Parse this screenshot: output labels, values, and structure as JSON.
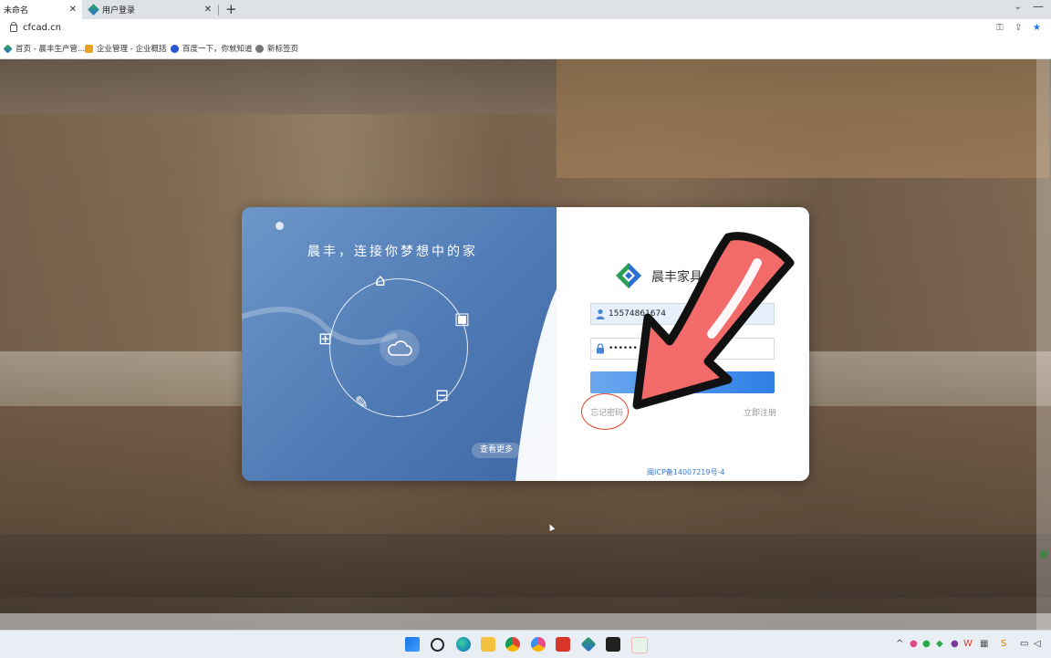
{
  "browser": {
    "tabs": [
      {
        "label": "未命名",
        "active": true
      },
      {
        "label": "用户登录",
        "active": false
      }
    ],
    "new_tab": "+",
    "url": "cfcad.cn",
    "bookmarks": [
      {
        "label": "首页 - 晨丰生产管..."
      },
      {
        "label": "企业管理 - 企业概括"
      },
      {
        "label": "百度一下，你就知道"
      },
      {
        "label": "新标签页"
      }
    ]
  },
  "login": {
    "slogan": "晨丰，连接你梦想中的家",
    "more_label": "查看更多",
    "brand_main": "晨丰家具",
    "brand_sub": "设",
    "username_value": "15574861674",
    "password_value": "••••••",
    "forgot_label": "忘记密码",
    "register_label": "立即注册",
    "icp": "闽ICP备14007219号-4"
  },
  "colors": {
    "accent": "#2f7fe6",
    "annotation_red": "#e2452f",
    "arrow_fill": "#f26a6a"
  }
}
